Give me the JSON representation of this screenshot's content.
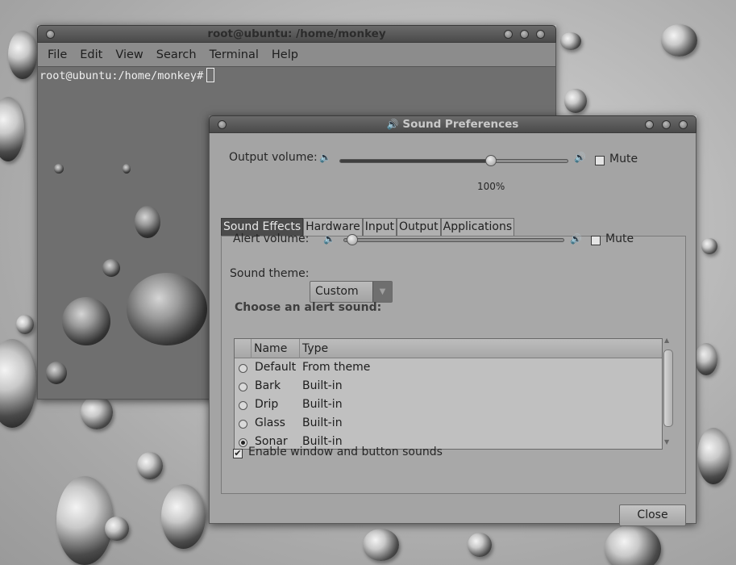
{
  "terminal": {
    "title": "root@ubuntu: /home/monkey",
    "menu": [
      "File",
      "Edit",
      "View",
      "Search",
      "Terminal",
      "Help"
    ],
    "prompt": "root@ubuntu:/home/monkey#"
  },
  "sound_prefs": {
    "title": "Sound Preferences",
    "output_volume_label": "Output volume:",
    "output_volume_percent": "100%",
    "output_volume_level": 0.66,
    "mute_label": "Mute",
    "output_muted": false,
    "tabs": [
      "Sound Effects",
      "Hardware",
      "Input",
      "Output",
      "Applications"
    ],
    "active_tab": "Sound Effects",
    "alert_volume_label": "Alert volume:",
    "alert_volume_level": 0.0,
    "alert_mute_label": "Mute",
    "alert_muted": false,
    "sound_theme_label": "Sound theme:",
    "sound_theme_value": "Custom",
    "choose_alert_label": "Choose an alert sound:",
    "columns": [
      "Name",
      "Type"
    ],
    "alert_sounds": [
      {
        "name": "Default",
        "type": "From theme",
        "selected": false
      },
      {
        "name": "Bark",
        "type": "Built-in",
        "selected": false
      },
      {
        "name": "Drip",
        "type": "Built-in",
        "selected": false
      },
      {
        "name": "Glass",
        "type": "Built-in",
        "selected": false
      },
      {
        "name": "Sonar",
        "type": "Built-in",
        "selected": true
      }
    ],
    "enable_sounds_label": "Enable window and button sounds",
    "enable_sounds_checked": true,
    "close_label": "Close"
  }
}
